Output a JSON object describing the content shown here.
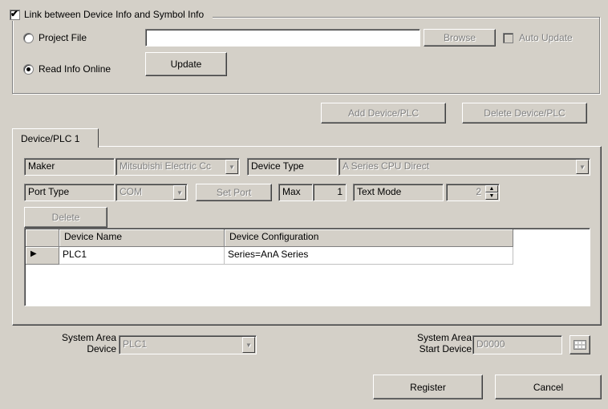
{
  "link_group": {
    "checkbox_label": "Link between Device Info and Symbol Info",
    "checked": true,
    "project_file_label": "Project File",
    "project_file_value": "",
    "browse_label": "Browse",
    "auto_update_label": "Auto Update",
    "read_online_label": "Read Info Online",
    "update_label": "Update",
    "selected_option": "Read Info Online"
  },
  "toolbar": {
    "add_label": "Add Device/PLC",
    "delete_label": "Delete Device/PLC"
  },
  "tabs": [
    {
      "label": "Device/PLC 1",
      "active": true
    }
  ],
  "device_panel": {
    "maker_label": "Maker",
    "maker_value": "Mitsubishi Electric Cc",
    "device_type_label": "Device Type",
    "device_type_value": "A Series CPU Direct",
    "port_type_label": "Port Type",
    "port_type_value": "COM",
    "set_port_label": "Set Port",
    "max_label": "Max",
    "max_value": "1",
    "text_mode_label": "Text Mode",
    "text_mode_value": "2",
    "delete_label": "Delete",
    "grid": {
      "columns": [
        "Device Name",
        "Device Configuration"
      ],
      "rows": [
        {
          "indicator": "▶",
          "device_name": "PLC1",
          "configuration": "Series=AnA Series"
        }
      ]
    }
  },
  "system_area": {
    "device_label_line1": "System Area",
    "device_label_line2": "Device",
    "device_value": "PLC1",
    "start_label_line1": "System Area",
    "start_label_line2": "Start Device",
    "start_value": "D0000"
  },
  "footer": {
    "register_label": "Register",
    "cancel_label": "Cancel"
  },
  "icons": {
    "checkbox_mark": "check-icon",
    "combo_arrow": "chevron-down-icon",
    "row_indicator": "triangle-right-icon",
    "device_picker": "keypad-icon"
  },
  "colors": {
    "face": "#d4d0c8",
    "shadow": "#808080",
    "disabled_text": "#808080"
  }
}
